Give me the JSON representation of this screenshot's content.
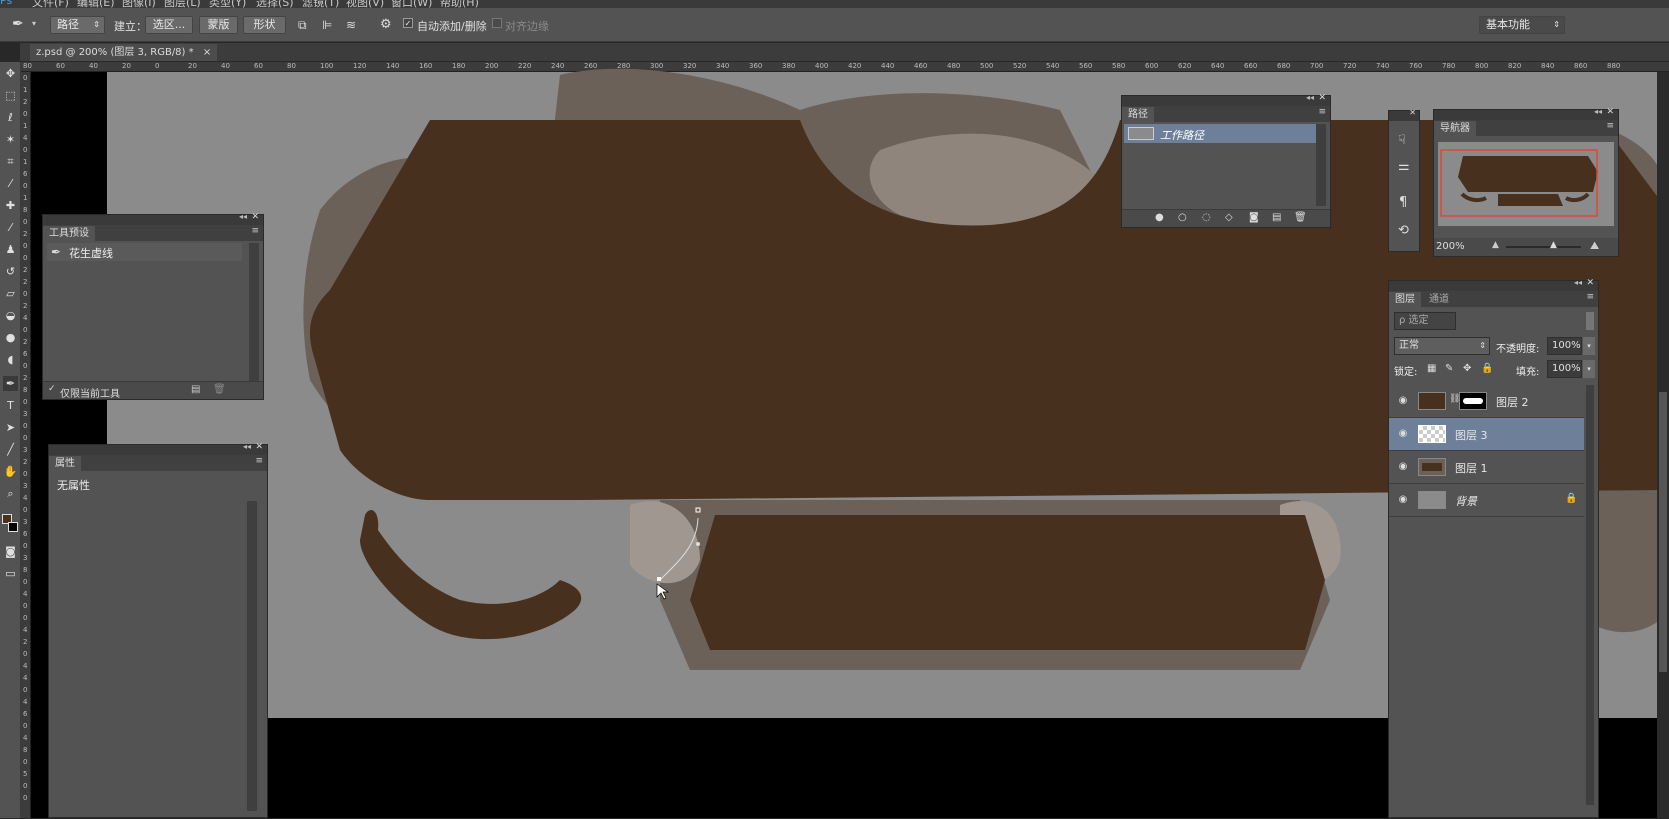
{
  "menu": [
    "文件(F)",
    "编辑(E)",
    "图像(I)",
    "图层(L)",
    "类型(Y)",
    "选择(S)",
    "滤镜(T)",
    "视图(V)",
    "窗口(W)",
    "帮助(H)"
  ],
  "options": {
    "mode_select": "路径",
    "make_label": "建立：",
    "selection_btn": "选区...",
    "mask_btn": "蒙版",
    "shape_btn": "形状",
    "auto_add_delete": "自动添加/删除",
    "align_edges": "对齐边缘",
    "workspace": "基本功能"
  },
  "document": {
    "tab_title": "z.psd @ 200% (图层 3, RGB/8) *",
    "close": "×"
  },
  "ruler": {
    "h_ticks": [
      "80",
      "60",
      "40",
      "20",
      "0",
      "20",
      "40",
      "60",
      "80",
      "100",
      "120",
      "140",
      "160",
      "180",
      "200",
      "220",
      "240",
      "260",
      "280",
      "300",
      "320",
      "340",
      "360",
      "380",
      "400",
      "420",
      "440",
      "460",
      "480",
      "500",
      "520",
      "540",
      "560",
      "580",
      "600",
      "620",
      "640",
      "660",
      "680",
      "700",
      "720",
      "740",
      "760",
      "780",
      "800",
      "820",
      "840",
      "860",
      "880"
    ],
    "v_ticks": [
      "0",
      "1",
      "2",
      "0",
      "1",
      "4",
      "0",
      "1",
      "6",
      "0",
      "1",
      "8",
      "0",
      "2",
      "0",
      "0",
      "2",
      "2",
      "0",
      "2",
      "4",
      "0",
      "2",
      "6",
      "0",
      "2",
      "8",
      "0",
      "3",
      "0",
      "0",
      "3",
      "2",
      "0",
      "3",
      "4",
      "0",
      "3",
      "6",
      "0",
      "3",
      "8",
      "0",
      "4",
      "0",
      "0",
      "4",
      "2",
      "0",
      "4",
      "4",
      "0",
      "4",
      "6",
      "0",
      "4",
      "8",
      "0",
      "5",
      "0",
      "0"
    ]
  },
  "tool_presets": {
    "title": "工具预设",
    "item": "花生虚线",
    "current_only": "仅限当前工具"
  },
  "properties": {
    "title": "属性",
    "content": "无属性"
  },
  "paths": {
    "title": "路径",
    "item": "工作路径"
  },
  "navigator": {
    "title": "导航器",
    "zoom": "200%"
  },
  "layers": {
    "tabs": [
      "图层",
      "通道"
    ],
    "search": "ρ 选定",
    "blend": "正常",
    "opacity_label": "不透明度:",
    "opacity": "100%",
    "lock_label": "锁定:",
    "fill_label": "填充:",
    "fill": "100%",
    "items": [
      {
        "name": "图层 2",
        "selected": false
      },
      {
        "name": "图层 3",
        "selected": true
      },
      {
        "name": "图层 1",
        "selected": false
      },
      {
        "name": "背景",
        "selected": false
      }
    ]
  },
  "colors": {
    "brown": "#47301e",
    "taupe": "#6b6159",
    "canvas_gray": "#8b8b8b",
    "selected_layer": "#6d7f99",
    "nav_box": "#e0473a"
  }
}
